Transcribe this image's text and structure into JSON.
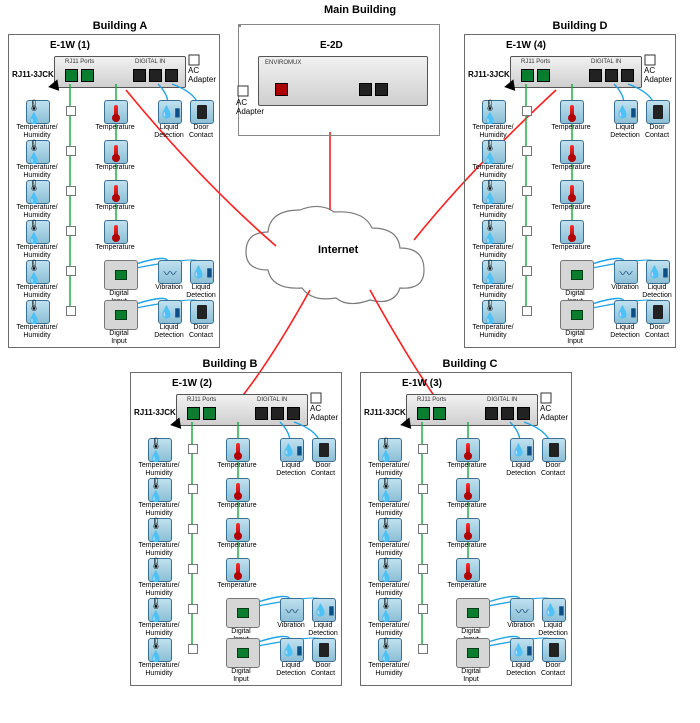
{
  "titles": {
    "main": "Main Building",
    "a": "Building A",
    "b": "Building B",
    "c": "Building C",
    "d": "Building D"
  },
  "devices": {
    "a": "E-1W (1)",
    "b": "E-1W (2)",
    "c": "E-1W (3)",
    "d": "E-1W (4)",
    "main": "E-2D"
  },
  "labels": {
    "ac": "AC\nAdapter",
    "rj": "RJ11-3JCK",
    "internet": "Internet",
    "rjports": "RJ11 Ports",
    "digital": "DIGITAL IN"
  },
  "sensors": {
    "th": "Temperature/\nHumidity",
    "t": "Temperature",
    "liq": "Liquid\nDetection",
    "door": "Door\nContact",
    "vib": "Vibration",
    "di": "Digital\nInput"
  },
  "common_building_layout": {
    "comment": "Each of the four outer buildings (A,B,C,D) has the same sensor topology wired to its E-1W unit.",
    "left_chain_sensor": "th",
    "left_chain_count": 6,
    "right_chain_sensor": "t",
    "right_chain_count": 4,
    "right_digital_tiles": [
      "di",
      "di"
    ],
    "di_branch_1": [
      "vib",
      "liq"
    ],
    "di_branch_2": [
      "liq",
      "door"
    ],
    "top_right_direct": [
      "liq",
      "door"
    ]
  }
}
